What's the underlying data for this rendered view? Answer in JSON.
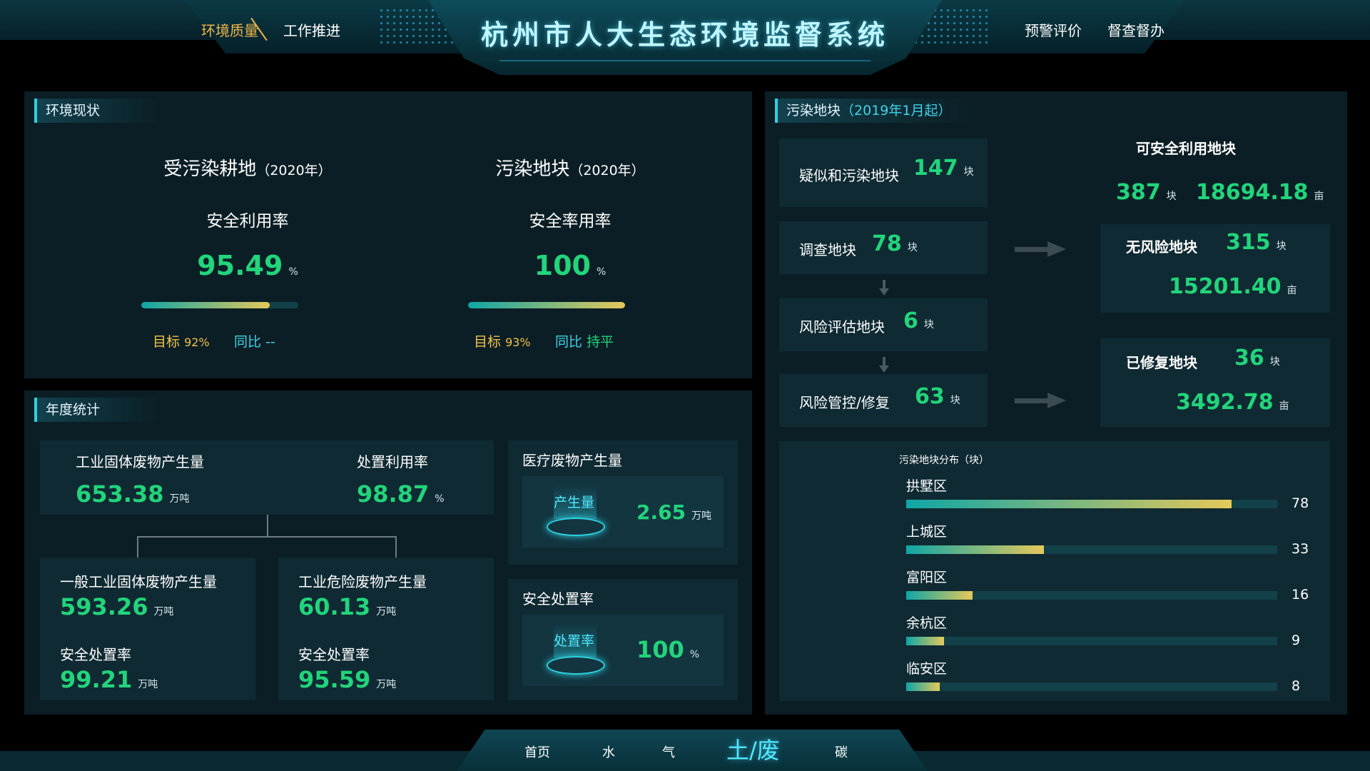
{
  "header": {
    "title": "杭州市人大生态环境监督系统",
    "nav_left": [
      "环境质量",
      "工作推进"
    ],
    "nav_right": [
      "预警评价",
      "督查督办"
    ]
  },
  "env_status": {
    "title": "环境现状",
    "farmland": {
      "name": "受污染耕地",
      "year": "（2020年）",
      "metric": "安全利用率",
      "value": "95.49",
      "unit": "%",
      "progress": 0.82,
      "target_label": "目标",
      "target_value": "92%",
      "yoy_label": "同比",
      "yoy_value": "--"
    },
    "plots": {
      "name": "污染地块",
      "year": "（2020年）",
      "metric": "安全率用率",
      "value": "100",
      "unit": "%",
      "progress": 1.0,
      "target_label": "目标",
      "target_value": "93%",
      "yoy_label": "同比",
      "yoy_value": "持平"
    }
  },
  "annual": {
    "title": "年度统计",
    "industrial": {
      "label": "工业固体废物产生量",
      "value": "653.38",
      "unit": "万吨"
    },
    "disposal": {
      "label": "处置利用率",
      "value": "98.87",
      "unit": "%"
    },
    "general": {
      "label": "一般工业固体废物产生量",
      "value": "593.26",
      "unit": "万吨",
      "rate_label": "安全处置率",
      "rate_value": "99.21",
      "rate_unit": "万吨"
    },
    "hazardous": {
      "label": "工业危险废物产生量",
      "value": "60.13",
      "unit": "万吨",
      "rate_label": "安全处置率",
      "rate_value": "95.59",
      "rate_unit": "万吨"
    },
    "medical": {
      "label": "医疗废物产生量",
      "badge": "产生量",
      "value": "2.65",
      "unit": "万吨"
    },
    "safe": {
      "label": "安全处置率",
      "badge": "处置率",
      "value": "100",
      "unit": "%"
    }
  },
  "contaminated": {
    "title": "污染地块",
    "subtitle": "（2019年1月起）",
    "suspected": {
      "label": "疑似和污染地块",
      "value": "147",
      "unit": "块"
    },
    "survey": {
      "label": "调查地块",
      "value": "78",
      "unit": "块"
    },
    "risk_eval": {
      "label": "风险评估地块",
      "value": "6",
      "unit": "块"
    },
    "risk_control": {
      "label": "风险管控/修复",
      "value": "63",
      "unit": "块"
    },
    "safe_use": {
      "label": "可安全利用地块",
      "count": "387",
      "count_unit": "块",
      "area": "18694.18",
      "area_unit": "亩"
    },
    "no_risk": {
      "label": "无风险地块",
      "count": "315",
      "count_unit": "块",
      "area": "15201.40",
      "area_unit": "亩"
    },
    "repaired": {
      "label": "已修复地块",
      "count": "36",
      "count_unit": "块",
      "area": "3492.78",
      "area_unit": "亩"
    }
  },
  "chart_data": {
    "type": "bar",
    "title": "污染地块分布（块）",
    "categories": [
      "拱墅区",
      "上城区",
      "富阳区",
      "余杭区",
      "临安区"
    ],
    "values": [
      78,
      33,
      16,
      9,
      8
    ],
    "xlim": [
      0,
      89
    ],
    "colors": {
      "start": "#0fa6a6",
      "end": "#e5c85a",
      "track": "#13414a"
    }
  },
  "bottom_nav": [
    "首页",
    "水",
    "气",
    "土/废",
    "碳"
  ],
  "bottom_active": 3
}
